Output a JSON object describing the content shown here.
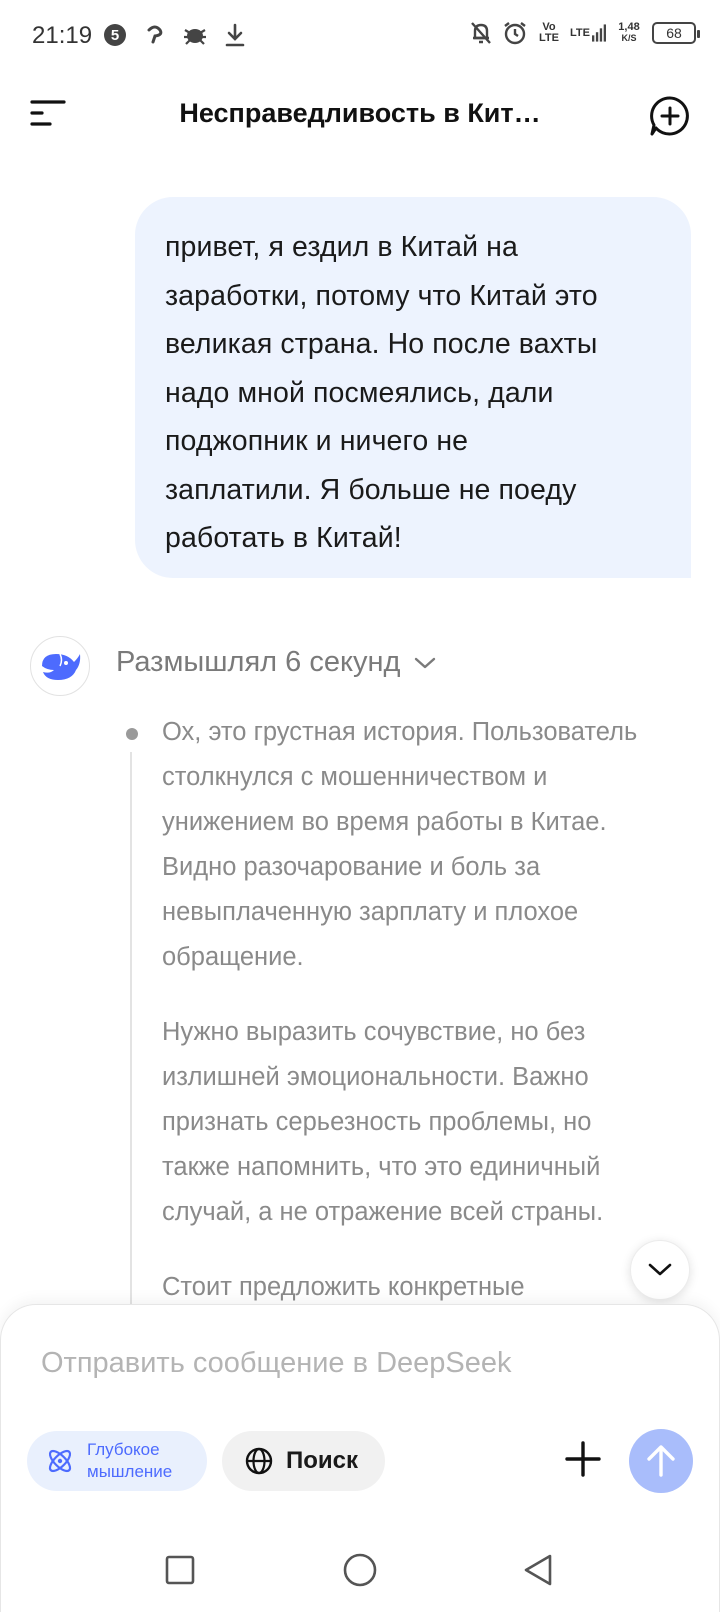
{
  "status_bar": {
    "time": "21:19",
    "notification_count": "5",
    "network_volte": [
      "Vo",
      "LTE"
    ],
    "network_lte": "LTE",
    "speed_value": "1,48",
    "speed_unit": "K/S",
    "battery": "68"
  },
  "header": {
    "title": "Несправедливость в Кит…"
  },
  "user_message": {
    "lines": [
      "привет, я ездил в Китай на",
      "заработки, потому что Китай это",
      "великая страна. Но после вахты",
      "надо мной посмеялись, дали",
      "поджопник и ничего не",
      "заплатили. Я больше не поеду",
      "работать в Китай!"
    ]
  },
  "assistant": {
    "thinking_label": "Размышлял 6 секунд",
    "thinking_paragraphs": [
      [
        "Ох, это грустная история. Пользователь",
        "столкнулся с мошенничеством и",
        "унижением во время работы в Китае.",
        "Видно разочарование и боль за",
        "невыплаченную зарплату и плохое",
        "обращение."
      ],
      [
        "Нужно выразить сочувствие, но без",
        "излишней эмоциональности. Важно",
        "признать серьезность проблемы, но",
        "также напомнить, что это единичный",
        "случай, а не отражение всей страны."
      ],
      [
        "Стоит предложить конкретные"
      ]
    ]
  },
  "input": {
    "placeholder": "Отправить сообщение в DeepSeek",
    "deep_think_label": [
      "Глубокое",
      "мышление"
    ],
    "search_label": "Поиск"
  },
  "colors": {
    "accent": "#4d6bfe",
    "user_bubble": "#edf3fe",
    "send_button": "#a9bdfb",
    "thinking_text": "#8a8a8a"
  }
}
